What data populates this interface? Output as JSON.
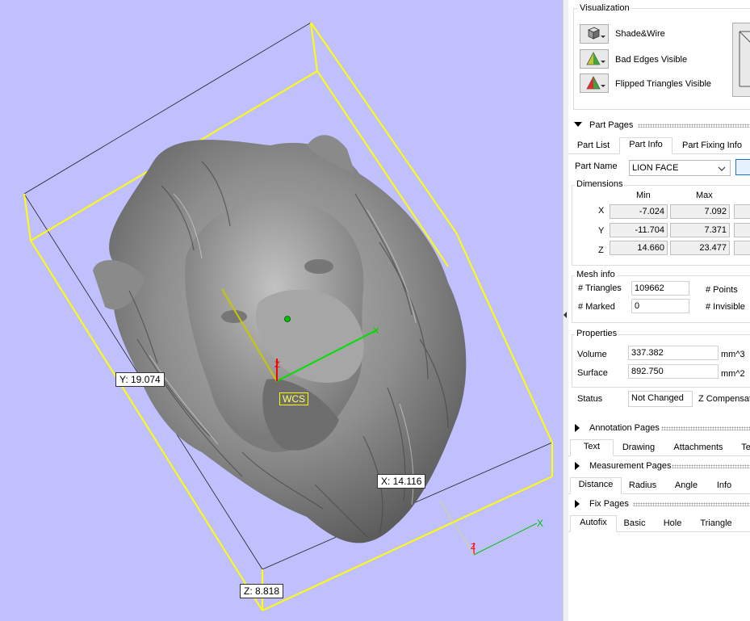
{
  "viewport": {
    "labels": {
      "y": "Y: 19.074",
      "x": "X: 14.116",
      "z": "Z: 8.818",
      "wcs": "WCS"
    },
    "axis_letters": {
      "x": "X",
      "z": "Z"
    },
    "colors": {
      "background": "#c0c0ff",
      "bounding_box": "#ffff00",
      "x_axis": "#00c000",
      "y_axis": "#c0c000",
      "z_axis": "#ff0000"
    }
  },
  "panel": {
    "visualization": {
      "title": "Visualization",
      "buttons": [
        {
          "label": "Shade&Wire",
          "icon": "shade-wire-icon"
        },
        {
          "label": "Bad Edges Visible",
          "icon": "bad-edges-icon"
        },
        {
          "label": "Flipped Triangles Visible",
          "icon": "flipped-triangles-icon"
        }
      ]
    },
    "part_pages": {
      "title": "Part Pages",
      "tabs": [
        "Part List",
        "Part Info",
        "Part Fixing Info"
      ],
      "active_tab": "Part Info",
      "part_name_label": "Part Name",
      "part_name_value": "LION FACE",
      "dimensions": {
        "title": "Dimensions",
        "col_min": "Min",
        "col_max": "Max",
        "rows": [
          {
            "axis": "X",
            "min": "-7.024",
            "max": "7.092"
          },
          {
            "axis": "Y",
            "min": "-11.704",
            "max": "7.371"
          },
          {
            "axis": "Z",
            "min": "14.660",
            "max": "23.477"
          }
        ]
      },
      "mesh_info": {
        "title": "Mesh info",
        "triangles_label": "# Triangles",
        "triangles_value": "109662",
        "points_label": "# Points",
        "marked_label": "# Marked",
        "marked_value": "0",
        "invisible_label": "# Invisible"
      },
      "properties": {
        "title": "Properties",
        "volume_label": "Volume",
        "volume_value": "337.382",
        "volume_unit": "mm^3",
        "surface_label": "Surface",
        "surface_value": "892.750",
        "surface_unit": "mm^2"
      },
      "status_label": "Status",
      "status_value": "Not Changed",
      "z_comp_label": "Z Compensat"
    },
    "annotation_pages": {
      "title": "Annotation Pages",
      "tabs": [
        "Text",
        "Drawing",
        "Attachments",
        "Te"
      ]
    },
    "measurement_pages": {
      "title": "Measurement Pages",
      "tabs": [
        "Distance",
        "Radius",
        "Angle",
        "Info"
      ]
    },
    "fix_pages": {
      "title": "Fix Pages",
      "tabs": [
        "Autofix",
        "Basic",
        "Hole",
        "Triangle"
      ]
    }
  }
}
